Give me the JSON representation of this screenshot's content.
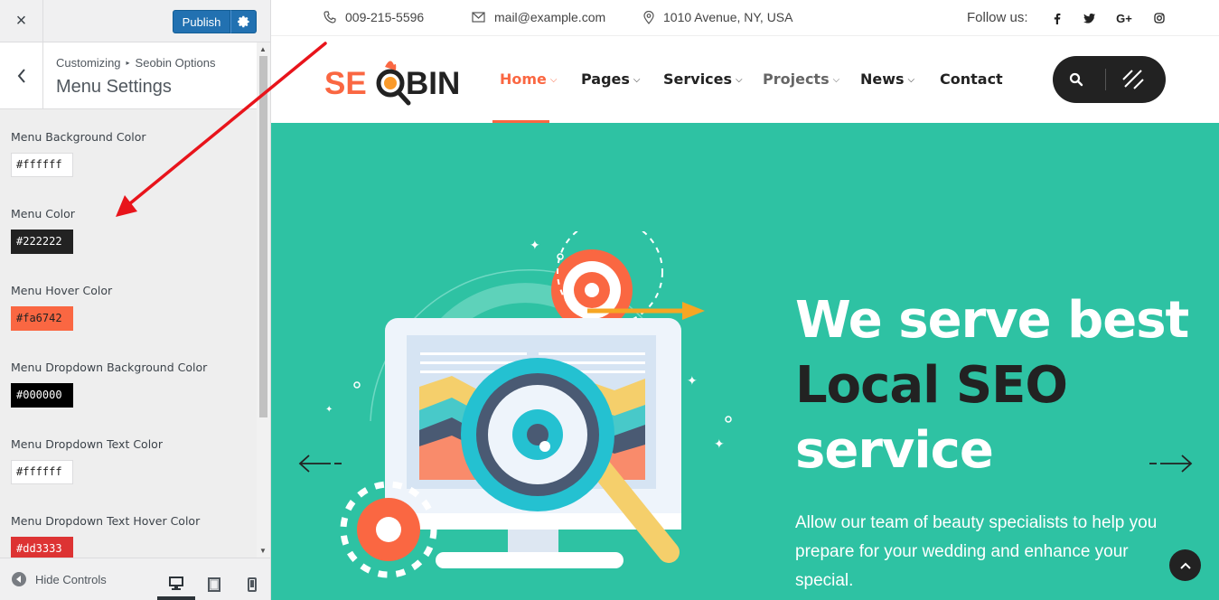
{
  "customizer": {
    "close_icon": "×",
    "publish_label": "Publish",
    "breadcrumb_root": "Customizing",
    "breadcrumb_sep": "▸",
    "breadcrumb_section": "Seobin Options",
    "section_title": "Menu Settings",
    "controls": [
      {
        "label": "Menu Background Color",
        "value": "#ffffff"
      },
      {
        "label": "Menu Color",
        "value": "#222222"
      },
      {
        "label": "Menu Hover Color",
        "value": "#fa6742"
      },
      {
        "label": "Menu Dropdown Background Color",
        "value": "#000000"
      },
      {
        "label": "Menu Dropdown Text Color",
        "value": "#ffffff"
      },
      {
        "label": "Menu Dropdown Text Hover Color",
        "value": "#dd3333"
      }
    ],
    "hide_controls_label": "Hide Controls"
  },
  "site": {
    "topbar": {
      "phone": "009-215-5596",
      "email": "mail@example.com",
      "address": "1010 Avenue, NY, USA",
      "follow_label": "Follow us:",
      "social": [
        "f",
        "t",
        "G+",
        "ig"
      ]
    },
    "logo": {
      "text_left": "SE",
      "text_right": "BIN"
    },
    "nav": [
      {
        "label": "Home",
        "active": true
      },
      {
        "label": "Pages"
      },
      {
        "label": "Services"
      },
      {
        "label": "Projects"
      },
      {
        "label": "News"
      },
      {
        "label": "Contact"
      }
    ],
    "hero": {
      "line1": "We serve best",
      "line2": "Local SEO",
      "line3": "service",
      "text": "Allow our team of beauty specialists to help you prepare for your wedding and enhance your special."
    }
  },
  "colors": {
    "accent": "#fa6742",
    "hero_bg": "#2ec2a3",
    "publish_blue": "#2271b1",
    "annotation_red": "#e8141b"
  }
}
